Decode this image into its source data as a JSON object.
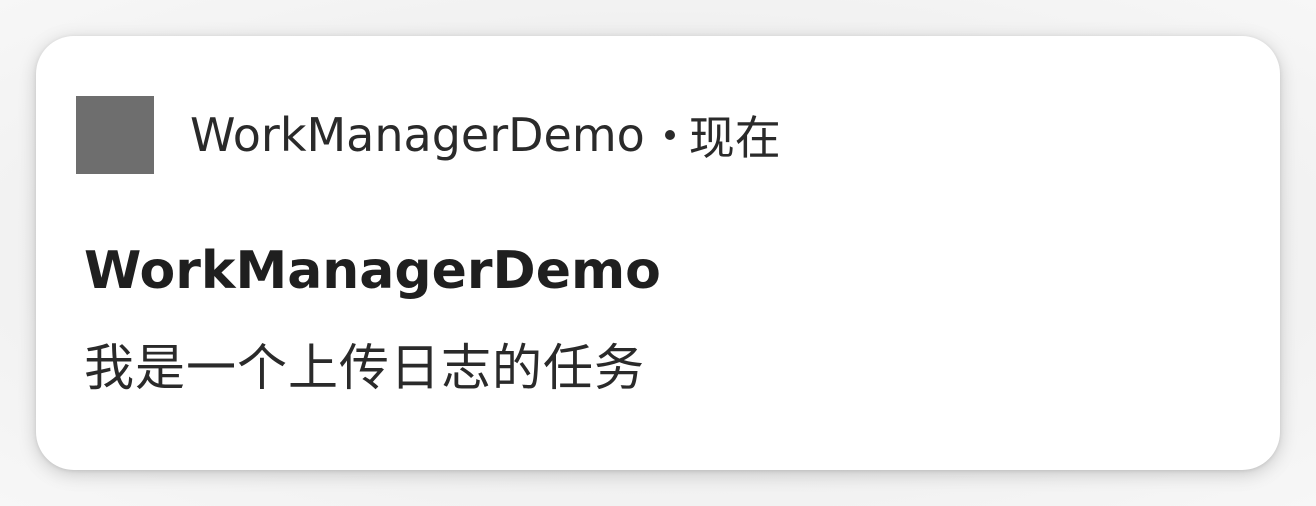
{
  "notification": {
    "app_name": "WorkManagerDemo",
    "separator": "•",
    "time": "现在",
    "title": "WorkManagerDemo",
    "text": "我是一个上传日志的任务",
    "icon": "app-icon-placeholder",
    "icon_color": "#6e6e6e",
    "card_color": "#ffffff"
  }
}
